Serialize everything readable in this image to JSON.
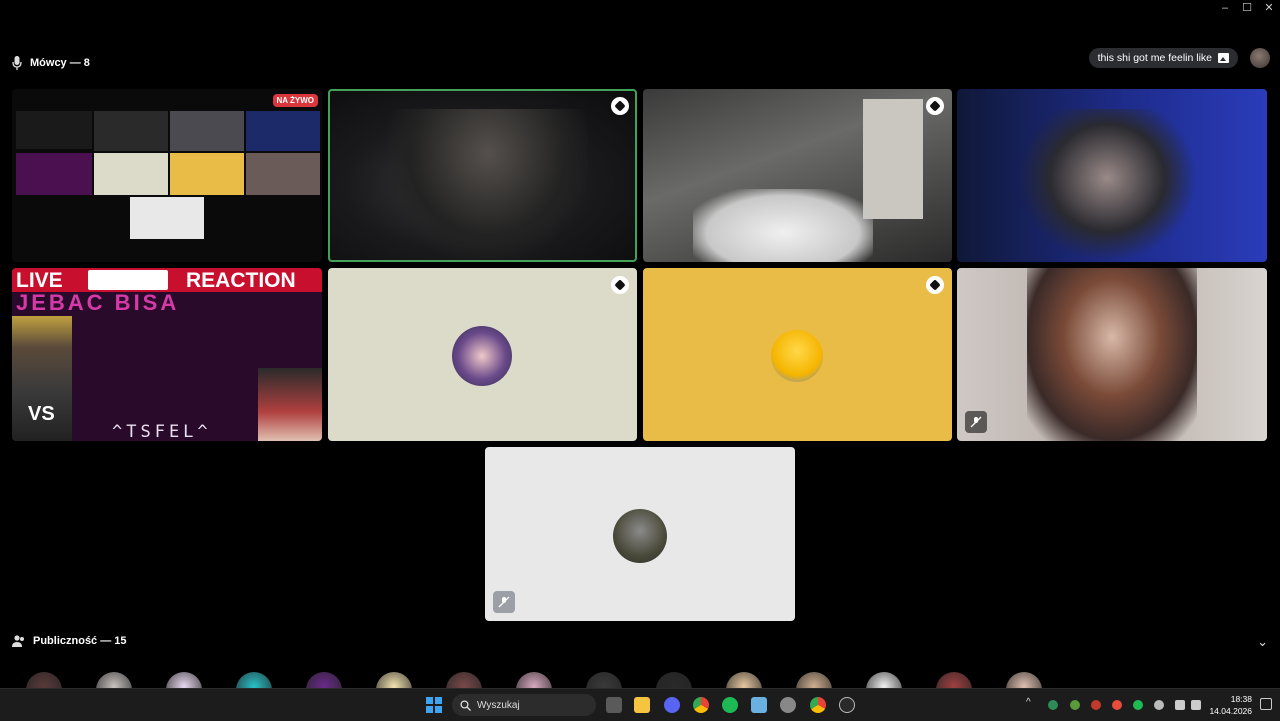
{
  "window_controls": {
    "minimize": "–",
    "maximize": "☐",
    "close": "✕"
  },
  "stage": {
    "header_label": "Mówcy — 8",
    "status_text": "this shi got me feelin like"
  },
  "tiles": {
    "stream": {
      "live_badge": "NA ŻYWO",
      "live_word": "LIVE",
      "reaction_word": "REACTION",
      "banner_text": "JEBAC BISA",
      "signature": "^TSFEL^",
      "vs_text": "VS"
    }
  },
  "audience": {
    "header_label": "Publiczność — 15",
    "avatar_colors": [
      "#5a3a3a",
      "#c9c2c0",
      "#e8d8f0",
      "#29c1c9",
      "#6a2a8a",
      "#f3e3b0",
      "#7a4a4a",
      "#d8a8c0",
      "#3a3a3a",
      "#2a2a2a",
      "#e8c8a0",
      "#d0b090",
      "#f0f0f0",
      "#a04040",
      "#e0c0b0"
    ]
  },
  "taskbar": {
    "search_placeholder": "Wyszukaj",
    "clock_time": "18:38",
    "clock_date": "14.04.2026"
  },
  "colors": {
    "speaking_ring": "#43a25a",
    "live_red": "#da373c",
    "tile_beige": "#dcdac9",
    "tile_yellow": "#e9bc47",
    "tile_light": "#e8e8e8"
  }
}
